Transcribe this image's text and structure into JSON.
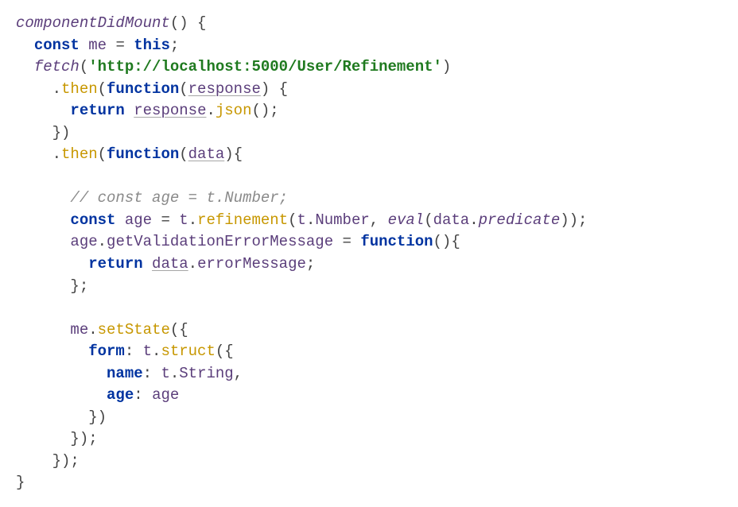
{
  "code": {
    "line1": {
      "fn": "componentDidMount",
      "rest": "() {"
    },
    "line2": {
      "kw1": "const",
      "var": "me",
      "eq": " = ",
      "kw2": "this",
      "end": ";"
    },
    "line3": {
      "fn": "fetch",
      "open": "(",
      "str": "'http://localhost:5000/User/Refinement'",
      "close": ")"
    },
    "line4": {
      "dot": ".",
      "then": "then",
      "open": "(",
      "kw": "function",
      "open2": "(",
      "param": "response",
      "close": ") {"
    },
    "line5": {
      "kw": "return",
      "sp": " ",
      "obj": "response",
      "dot": ".",
      "call": "json",
      "rest": "();"
    },
    "line6": {
      "close": "})"
    },
    "line7": {
      "dot": ".",
      "then": "then",
      "open": "(",
      "kw": "function",
      "open2": "(",
      "param": "data",
      "close": "){"
    },
    "line8": {
      "blank": ""
    },
    "line9": {
      "cmt": "// const age = t.Number;"
    },
    "line10": {
      "kw": "const",
      "var": "age",
      "eq": " = ",
      "t": "t",
      "dot1": ".",
      "ref": "refinement",
      "open": "(",
      "t2": "t",
      "dot2": ".",
      "num": "Number",
      "comma": ", ",
      "eval": "eval",
      "open2": "(",
      "data": "data",
      "dot3": ".",
      "pred": "predicate",
      "close": "));"
    },
    "line11": {
      "age": "age",
      "dot": ".",
      "gvem": "getValidationErrorMessage",
      "eq": " = ",
      "kw": "function",
      "rest": "(){"
    },
    "line12": {
      "kw": "return",
      "sp": " ",
      "data": "data",
      "dot": ".",
      "err": "errorMessage",
      "end": ";"
    },
    "line13": {
      "close": "};"
    },
    "line14": {
      "blank": ""
    },
    "line15": {
      "me": "me",
      "dot": ".",
      "set": "setState",
      "rest": "({"
    },
    "line16": {
      "key": "form",
      "sep": ": ",
      "t": "t",
      "dot": ".",
      "struct": "struct",
      "rest": "({"
    },
    "line17": {
      "key": "name",
      "sep": ": ",
      "t": "t",
      "dot": ".",
      "type": "String",
      "end": ","
    },
    "line18": {
      "key": "age",
      "sep": ": ",
      "val": "age"
    },
    "line19": {
      "close": "})"
    },
    "line20": {
      "close": "});"
    },
    "line21": {
      "close": "});"
    },
    "line22": {
      "close": "}"
    }
  }
}
